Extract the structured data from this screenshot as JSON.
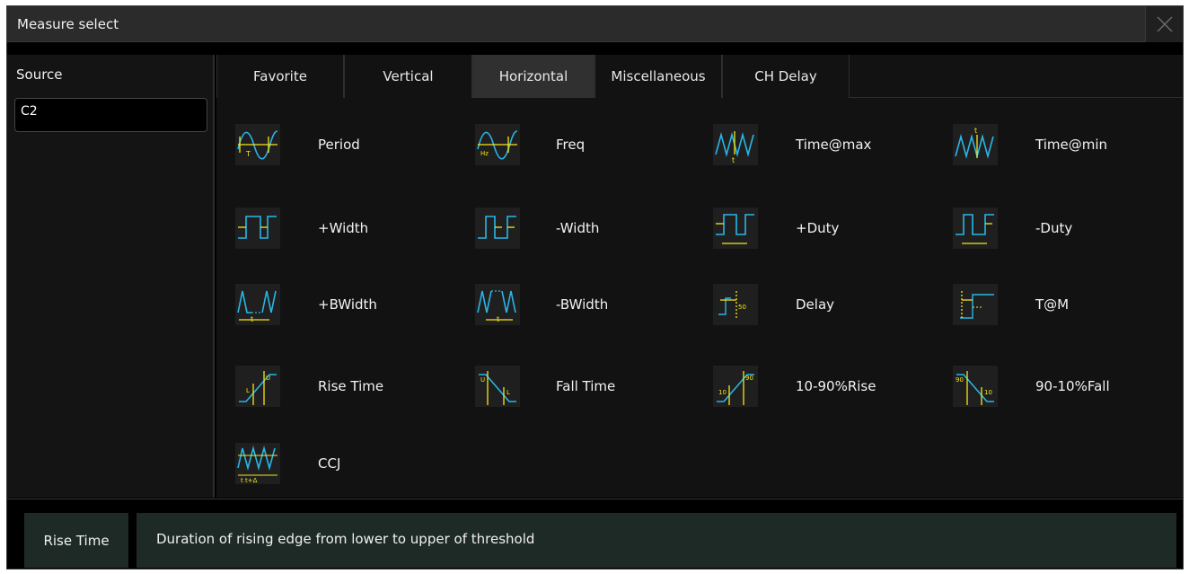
{
  "window": {
    "title": "Measure select"
  },
  "left": {
    "source_label": "Source",
    "source_value": "C2"
  },
  "tabs": [
    {
      "label": "Favorite",
      "active": false
    },
    {
      "label": "Vertical",
      "active": false
    },
    {
      "label": "Horizontal",
      "active": true
    },
    {
      "label": "Miscellaneous",
      "active": false
    },
    {
      "label": "CH Delay",
      "active": false
    }
  ],
  "items": [
    {
      "label": "Period",
      "icon": "period-icon"
    },
    {
      "label": "Freq",
      "icon": "freq-icon"
    },
    {
      "label": "Time@max",
      "icon": "time-max-icon"
    },
    {
      "label": "Time@min",
      "icon": "time-min-icon"
    },
    {
      "label": "+Width",
      "icon": "pos-width-icon"
    },
    {
      "label": "-Width",
      "icon": "neg-width-icon"
    },
    {
      "label": "+Duty",
      "icon": "pos-duty-icon"
    },
    {
      "label": "-Duty",
      "icon": "neg-duty-icon"
    },
    {
      "label": "+BWidth",
      "icon": "pos-bwidth-icon"
    },
    {
      "label": "-BWidth",
      "icon": "neg-bwidth-icon"
    },
    {
      "label": "Delay",
      "icon": "delay-icon"
    },
    {
      "label": "T@M",
      "icon": "t-at-m-icon"
    },
    {
      "label": "Rise Time",
      "icon": "rise-time-icon"
    },
    {
      "label": "Fall Time",
      "icon": "fall-time-icon"
    },
    {
      "label": "10-90%Rise",
      "icon": "rise-10-90-icon"
    },
    {
      "label": "90-10%Fall",
      "icon": "fall-90-10-icon"
    },
    {
      "label": "CCJ",
      "icon": "ccj-icon"
    }
  ],
  "icon_text": {
    "period": "T",
    "freq": "Hz",
    "time_mark": "t",
    "delay": "50",
    "upper": "U",
    "lower": "L",
    "pct10": "10",
    "pct90": "90",
    "ccj": "t t+Δ"
  },
  "description": {
    "name": "Rise Time",
    "text": "Duration of rising edge from lower to upper of threshold"
  },
  "colors": {
    "wave": "#29b6e8",
    "marker": "#f5e61a",
    "selected_bg": "#1e2a26"
  }
}
